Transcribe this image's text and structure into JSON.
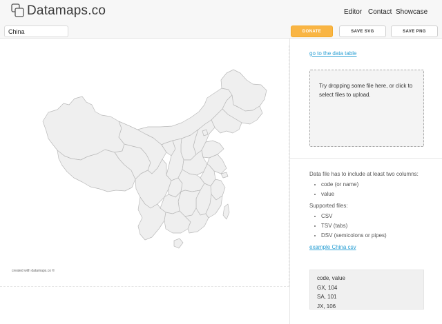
{
  "header": {
    "logo_text": "Datamaps.co",
    "nav": [
      "Editor",
      "Contact",
      "Showcase"
    ]
  },
  "toolbar": {
    "map_value": "China",
    "donate_label": "DONATE",
    "save_svg_label": "SAVE SVG",
    "save_png_label": "SAVE PNG"
  },
  "map": {
    "credit": "created with datamaps.co ©",
    "fill": "#efefef",
    "stroke": "#b9b9b9"
  },
  "sidebar": {
    "data_table_link": "go to the data table",
    "dropzone_text": "Try dropping some file here, or click to select files to upload.",
    "requirement_text": "Data file has to include at least two columns:",
    "columns": [
      "code (or name)",
      "value"
    ],
    "supported_label": "Supported files:",
    "formats": [
      "CSV",
      "TSV (tabs)",
      "DSV (semicolons or pipes)"
    ],
    "example_link": "example China csv",
    "sample_lines": [
      "code, value",
      "GX, 104",
      "SA, 101",
      "JX, 106"
    ]
  },
  "colors": {
    "accent_link": "#2ba0d4",
    "donate": "#f9b544"
  }
}
